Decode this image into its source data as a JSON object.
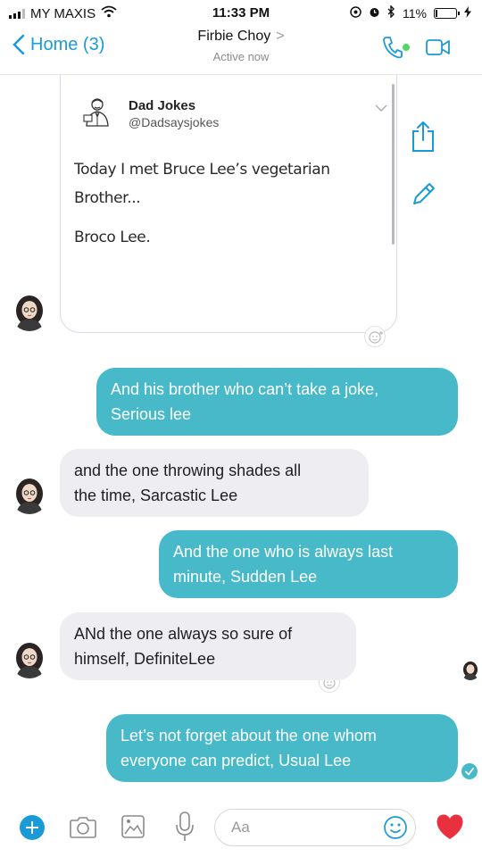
{
  "status_bar": {
    "carrier": "MY MAXIS",
    "time": "11:33 PM",
    "battery": "11%",
    "battery_level": 0.11
  },
  "header": {
    "back_label": "Home (3)",
    "contact_name": "Firbie Choy",
    "chevron": ">",
    "status": "Active now"
  },
  "shared_post": {
    "author": "Dad Jokes",
    "handle": "@Dadsaysjokes",
    "lines": [
      "Today I met Bruce Lee’s vegetarian",
      "Brother...",
      "Broco Lee."
    ]
  },
  "messages": [
    {
      "from": "me",
      "lines": [
        "And his brother who can’t take a joke,",
        "Serious lee"
      ]
    },
    {
      "from": "them",
      "lines": [
        "and the one throwing shades all",
        "the time, Sarcastic Lee"
      ]
    },
    {
      "from": "me",
      "lines": [
        "And the one who is always last",
        "minute, Sudden Lee"
      ]
    },
    {
      "from": "them",
      "lines": [
        "ANd the one always so sure of",
        "himself, DefiniteLee"
      ]
    },
    {
      "from": "me",
      "lines": [
        "Let’s not forget about the one whom",
        "everyone can predict, Usual Lee"
      ]
    }
  ],
  "composer": {
    "placeholder": "Aa"
  },
  "colors": {
    "accent": "#1a9bd7",
    "outgoing_bubble": "#47b9c9",
    "incoming_bubble": "#eeedf2",
    "like": "#e8303e",
    "online": "#4cd964"
  },
  "icons": [
    "signal-icon",
    "wifi-icon",
    "at-icon",
    "alarm-icon",
    "bluetooth-icon",
    "battery-icon",
    "charging-icon",
    "back-chevron-icon",
    "phone-icon",
    "video-icon",
    "share-icon",
    "edit-icon",
    "emoji-add-icon",
    "plus-icon",
    "camera-icon",
    "image-icon",
    "microphone-icon",
    "emoji-icon",
    "heart-icon",
    "check-icon"
  ]
}
